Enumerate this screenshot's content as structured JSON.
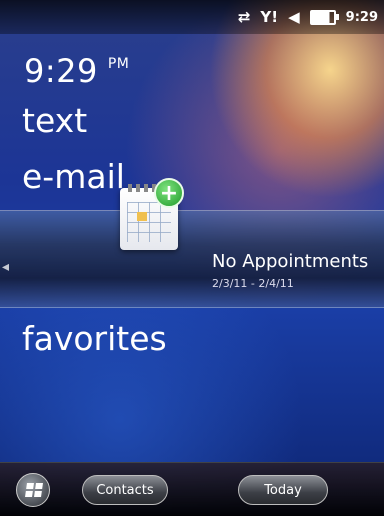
{
  "status": {
    "sync_icon": "sync-arrows-icon",
    "signal_icon": "signal-icon",
    "volume_icon": "volume-icon",
    "battery_icon": "battery-icon",
    "time": "9:29"
  },
  "clock": {
    "time": "9:29",
    "ampm": "PM"
  },
  "menu": {
    "text": "text",
    "email": "e-mail",
    "favorites": "favorites"
  },
  "calendar": {
    "title": "No Appointments",
    "dates": "2/3/11 - 2/4/11",
    "icon": "calendar-add-icon"
  },
  "softkeys": {
    "left": "Contacts",
    "right": "Today",
    "start_icon": "windows-start-icon"
  }
}
